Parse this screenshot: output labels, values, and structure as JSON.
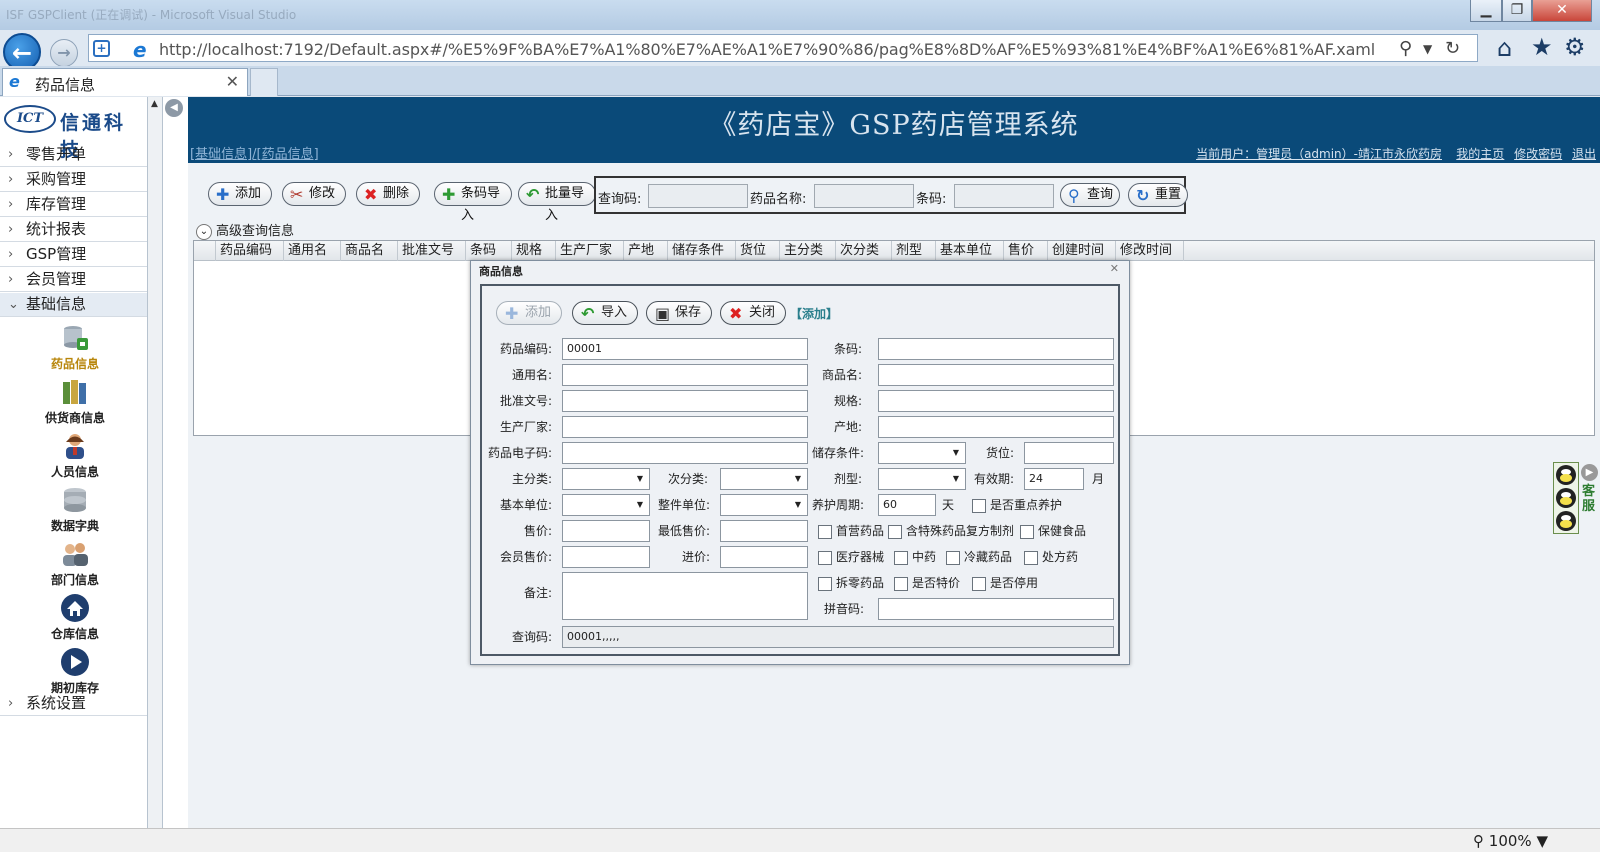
{
  "browser": {
    "window_title": "ISF GSPClient (正在调试) - Microsoft Visual Studio",
    "url": "http://localhost:7192/Default.aspx#/%E5%9F%BA%E7%A1%80%E7%AE%A1%E7%90%86/pag%E8%8D%AF%E5%93%81%E4%BF%A1%E6%81%AF.xaml",
    "tab_title": "药品信息",
    "zoom": "100%"
  },
  "logo": {
    "mark": "ICT",
    "name": "信通科技"
  },
  "sidebar": {
    "menu": [
      {
        "label": "零售开单"
      },
      {
        "label": "采购管理"
      },
      {
        "label": "库存管理"
      },
      {
        "label": "统计报表"
      },
      {
        "label": "GSP管理"
      },
      {
        "label": "会员管理"
      },
      {
        "label": "基础信息"
      }
    ],
    "sub_items": [
      {
        "label": "药品信息"
      },
      {
        "label": "供货商信息"
      },
      {
        "label": "人员信息"
      },
      {
        "label": "数据字典"
      },
      {
        "label": "部门信息"
      },
      {
        "label": "仓库信息"
      },
      {
        "label": "期初库存"
      }
    ],
    "settings": "系统设置"
  },
  "header": {
    "title": "《药店宝》GSP药店管理系统",
    "breadcrumb": "[基础信息]/[药品信息]",
    "user": "当前用户：管理员（admin）-靖江市永欣药房",
    "links": [
      "我的主页",
      "修改密码",
      "退出"
    ]
  },
  "toolbar": {
    "add": "添加",
    "edit": "修改",
    "delete": "删除",
    "barcode_import": "条码导入",
    "batch_import": "批量导入"
  },
  "search": {
    "query_code_label": "查询码:",
    "drug_name_label": "药品名称:",
    "barcode_label": "条码:",
    "query_button": "查询",
    "reset_button": "重置"
  },
  "advanced_query": "高级查询信息",
  "grid": {
    "columns": [
      "药品编码",
      "通用名",
      "商品名",
      "批准文号",
      "条码",
      "规格",
      "生产厂家",
      "产地",
      "储存条件",
      "货位",
      "主分类",
      "次分类",
      "剂型",
      "基本单位",
      "售价",
      "创建时间",
      "修改时间"
    ]
  },
  "customer_service": "客服",
  "dialog": {
    "title": "商品信息",
    "buttons": {
      "add": "添加",
      "import": "导入",
      "save": "保存",
      "close": "关闭"
    },
    "mode": "【添加】",
    "labels": {
      "drug_code": "药品编码:",
      "barcode": "条码:",
      "generic_name": "通用名:",
      "trade_name": "商品名:",
      "approval_no": "批准文号:",
      "spec": "规格:",
      "manufacturer": "生产厂家:",
      "origin": "产地:",
      "e_code": "药品电子码:",
      "storage": "储存条件:",
      "location": "货位:",
      "main_category": "主分类:",
      "sub_category": "次分类:",
      "dosage_form": "剂型:",
      "validity": "有效期:",
      "validity_unit": "月",
      "base_unit": "基本单位:",
      "whole_unit": "整件单位:",
      "care_cycle": "养护周期:",
      "care_cycle_unit": "天",
      "price": "售价:",
      "min_price": "最低售价:",
      "member_price": "会员售价:",
      "purchase_price": "进价:",
      "remark": "备注:",
      "pinyin": "拼音码:",
      "query_code": "查询码:"
    },
    "values": {
      "drug_code": "00001",
      "validity": "24",
      "care_cycle": "60",
      "query_code": "00001,,,,,"
    },
    "checkboxes": {
      "key_care": "是否重点养护",
      "first_drug": "首营药品",
      "special_compound": "含特殊药品复方制剂",
      "health_food": "保健食品",
      "medical_device": "医疗器械",
      "chinese_medicine": "中药",
      "cold_storage": "冷藏药品",
      "prescription": "处方药",
      "split": "拆零药品",
      "special_price": "是否特价",
      "disabled": "是否停用"
    }
  }
}
